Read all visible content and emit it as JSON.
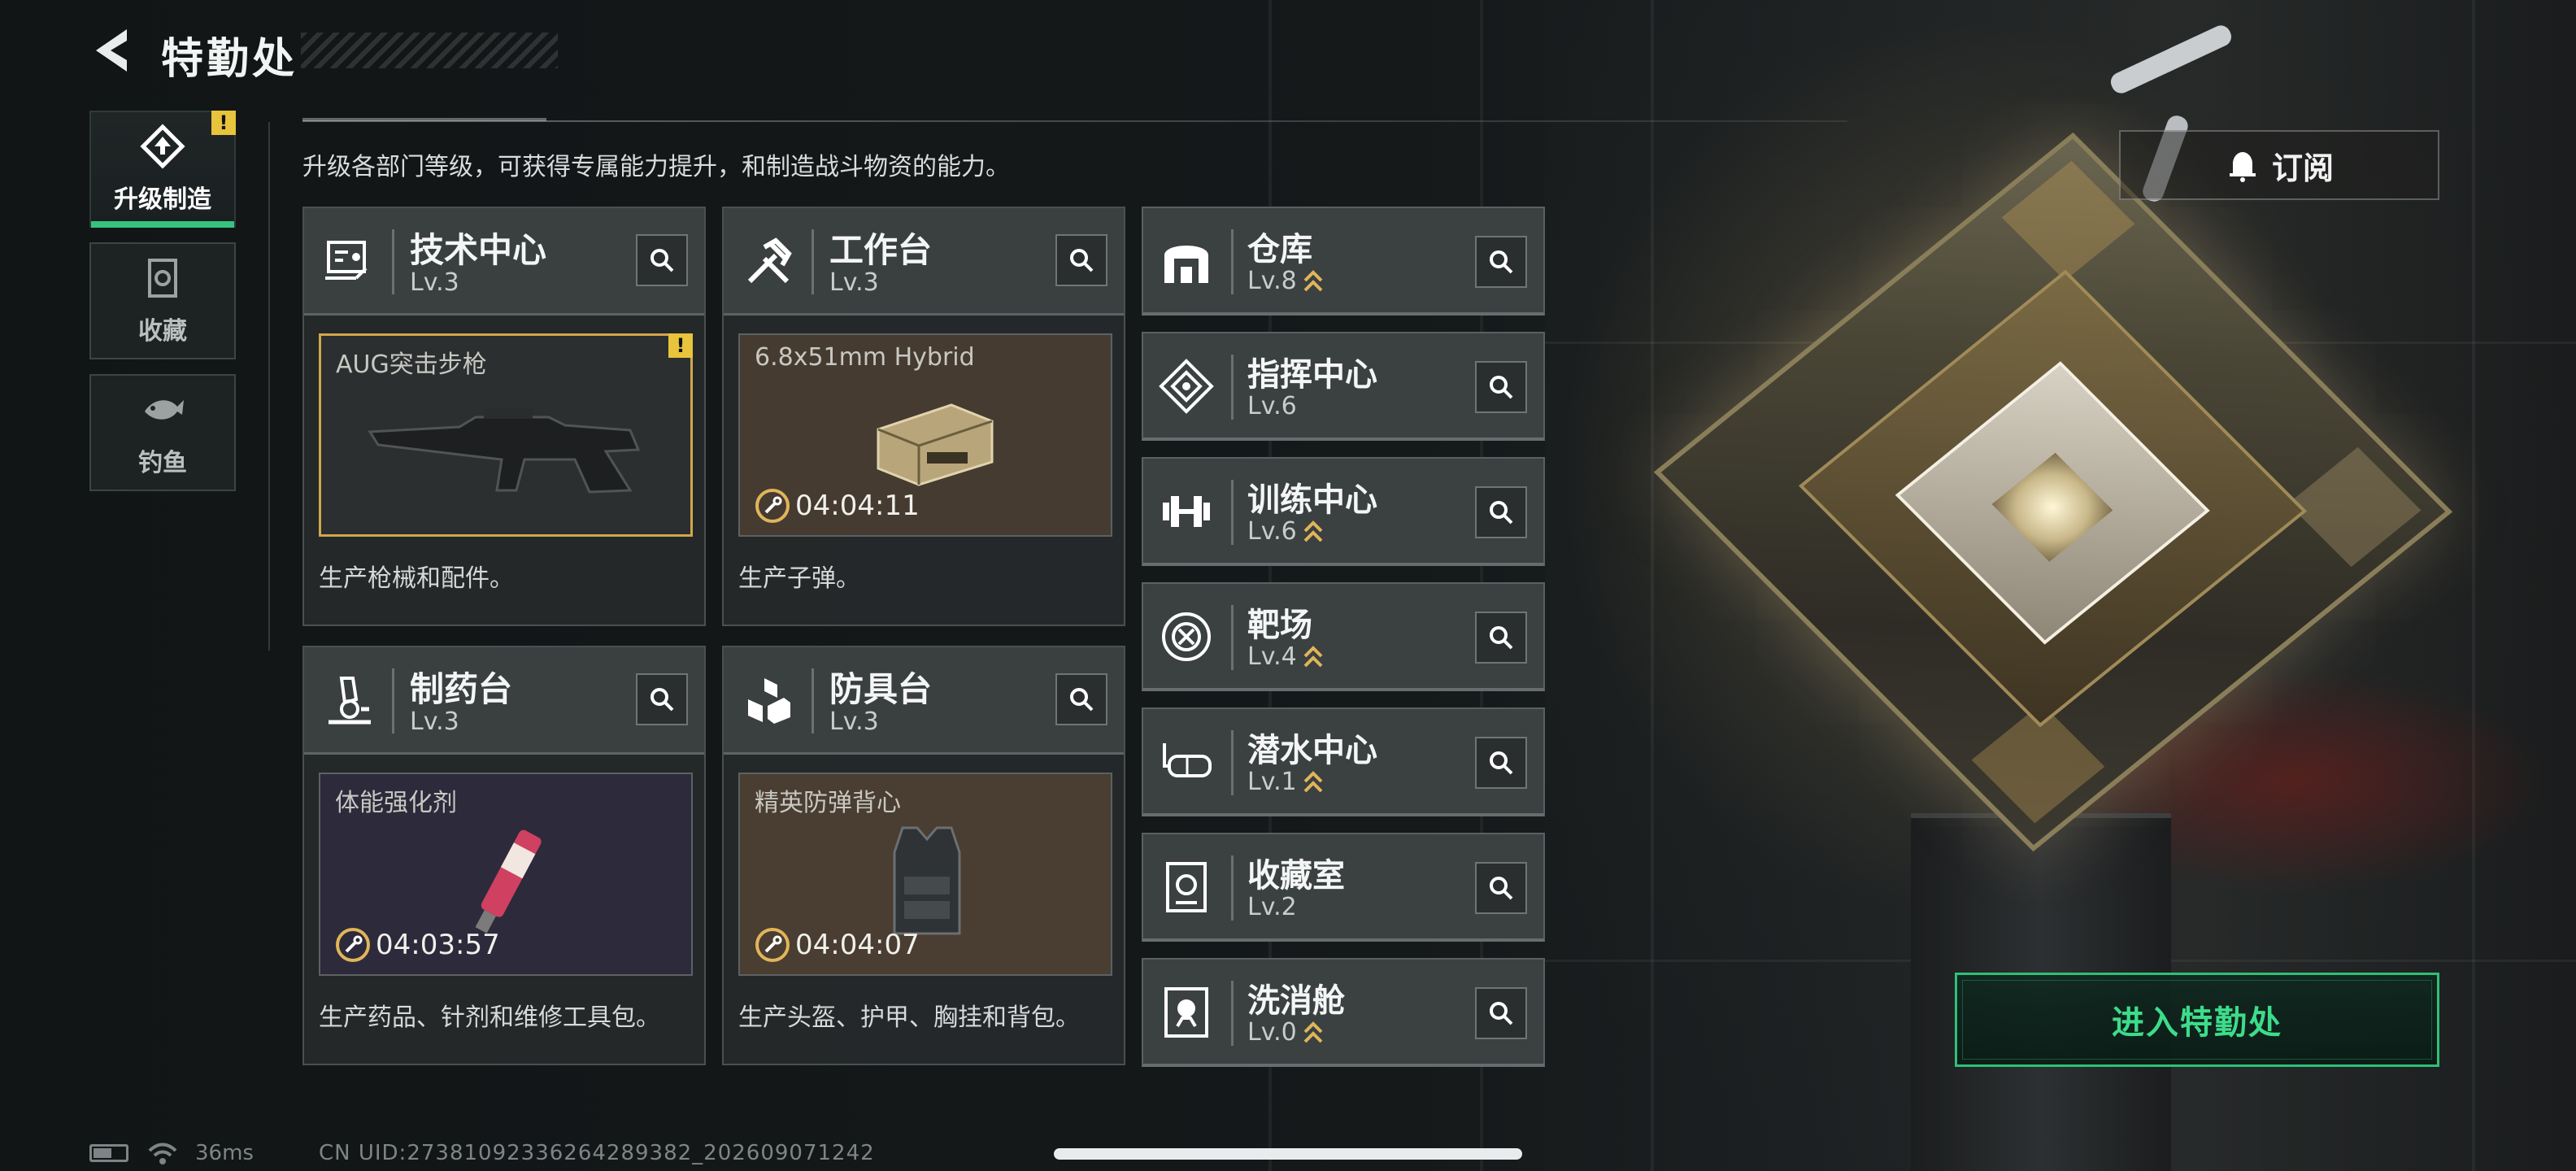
{
  "header": {
    "title": "特勤处"
  },
  "sidebar": {
    "tabs": [
      {
        "label": "升级制造",
        "icon": "upgrade-icon",
        "active": true,
        "warning": "!"
      },
      {
        "label": "收藏",
        "icon": "collection-icon",
        "active": false
      },
      {
        "label": "钓鱼",
        "icon": "fish-icon",
        "active": false
      }
    ]
  },
  "description": "升级各部门等级，可获得专属能力提升，和制造战斗物资的能力。",
  "workstations": [
    {
      "name": "技术中心",
      "level": "Lv.3",
      "item": "AUG突击步枪",
      "timer": "",
      "warning": "!",
      "desc": "生产枪械和配件。"
    },
    {
      "name": "工作台",
      "level": "Lv.3",
      "item": "6.8x51mm Hybrid",
      "timer": "04:04:11",
      "desc": "生产子弹。"
    },
    {
      "name": "制药台",
      "level": "Lv.3",
      "item": "体能强化剂",
      "timer": "04:03:57",
      "desc": "生产药品、针剂和维修工具包。"
    },
    {
      "name": "防具台",
      "level": "Lv.3",
      "item": "精英防弹背心",
      "timer": "04:04:07",
      "desc": "生产头盔、护甲、胸挂和背包。"
    }
  ],
  "facilities": [
    {
      "name": "仓库",
      "level": "Lv.8",
      "upgradable": true,
      "icon": "warehouse-icon"
    },
    {
      "name": "指挥中心",
      "level": "Lv.6",
      "upgradable": false,
      "icon": "command-center-icon"
    },
    {
      "name": "训练中心",
      "level": "Lv.6",
      "upgradable": true,
      "icon": "dumbbell-icon"
    },
    {
      "name": "靶场",
      "level": "Lv.4",
      "upgradable": true,
      "icon": "target-icon"
    },
    {
      "name": "潜水中心",
      "level": "Lv.1",
      "upgradable": true,
      "icon": "diving-mask-icon"
    },
    {
      "name": "收藏室",
      "level": "Lv.2",
      "upgradable": false,
      "icon": "collection-room-icon"
    },
    {
      "name": "洗消舱",
      "level": "Lv.0",
      "upgradable": true,
      "icon": "decontamination-icon"
    }
  ],
  "subscribe_label": "订阅",
  "enter_label": "进入特勤处",
  "status": {
    "ping": "36ms",
    "uid": "CN UID:27381092336264289382_202609071242"
  },
  "colors": {
    "accent_green": "#36c47d",
    "warning_yellow": "#e8c33c",
    "upgrade_arrow": "#e0b55a"
  }
}
